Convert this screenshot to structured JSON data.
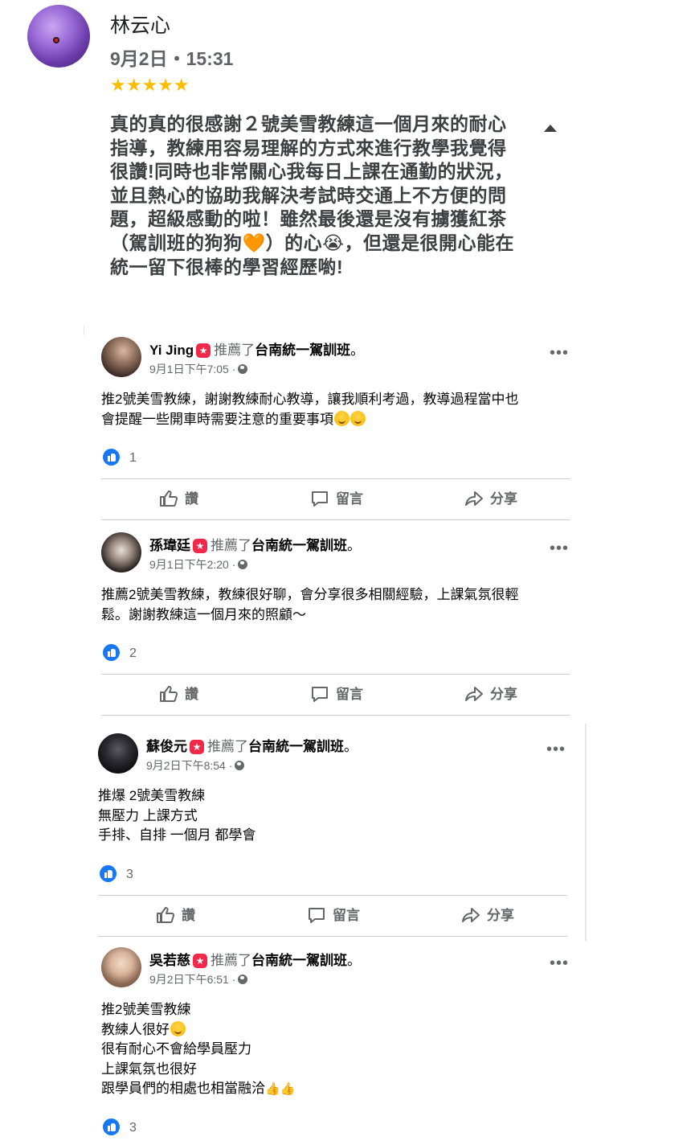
{
  "review": {
    "author": "林云心",
    "date": "9月2日・15:31",
    "stars": "★★★★★",
    "rating": 5,
    "text": "真的真的很感謝２號美雪教練這一個月來的耐心指導，教練用容易理解的方式來進行教學我覺得很讚!同時也非常關心我每日上課在通勤的狀況，並且熱心的協助我解決考試時交通上不方便的問題，超級感動的啦！雖然最後還是沒有擄獲紅茶（駕訓班的狗狗🧡）的心😭，但還是很開心能在統一留下很棒的學習經歷喲!"
  },
  "common": {
    "action_recommend": "推薦了",
    "page_name": "台南統一駕訓班",
    "period": "。",
    "badge_icon": "★",
    "more": "•••",
    "btn_like": "讚",
    "btn_comment": "留言",
    "btn_share": "分享",
    "colors": {
      "fb_blue": "#1877f2",
      "badge_red": "#f02849",
      "star_gold": "#fbbc04"
    }
  },
  "posts": [
    {
      "name": "Yi Jing",
      "time": "9月1日下午7:05 ·",
      "lines": [
        "推2號美雪教練，謝謝教練耐心教導，讓我順利考過，教導過程當中也",
        "會提醒一些開車時需要注意的重要事項"
      ],
      "likes": "1"
    },
    {
      "name": "孫瑋廷",
      "time": "9月1日下午2:20 ·",
      "lines": [
        "推薦2號美雪教練，教練很好聊，會分享很多相關經驗，上課氣氛很輕",
        "鬆。謝謝教練這一個月來的照顧～"
      ],
      "likes": "2"
    },
    {
      "name": "蘇俊元",
      "time": "9月2日下午8:54 ·",
      "lines": [
        "推爆 2號美雪教練",
        "無壓力 上課方式",
        "手排、自排 一個月 都學會"
      ],
      "likes": "3"
    },
    {
      "name": "吳若慈",
      "time": "9月2日下午6:51 ·",
      "lines": [
        "推2號美雪教練",
        "教練人很好",
        "很有耐心不會給學員壓力",
        "上課氣氛也很好",
        "跟學員們的相處也相當融洽"
      ],
      "likes": "3"
    }
  ]
}
